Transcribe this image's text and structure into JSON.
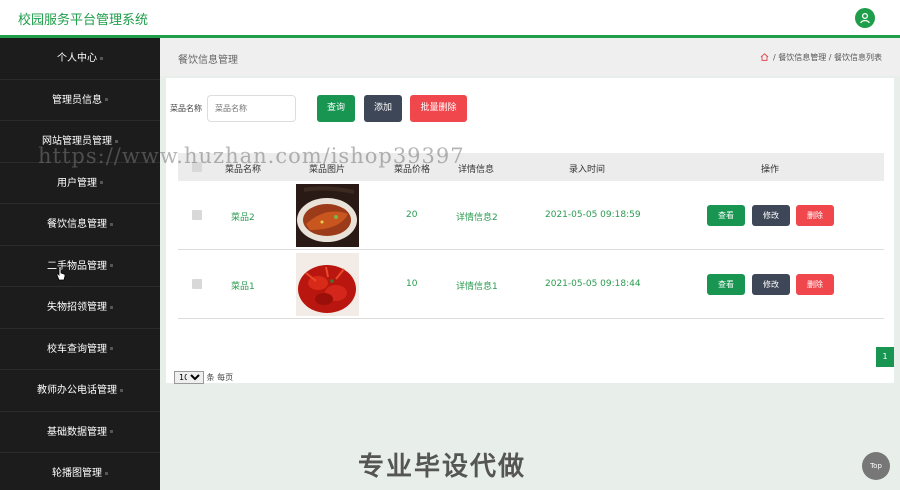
{
  "header": {
    "app_title": "校园服务平台管理系统",
    "user_icon": "user-icon",
    "accent": "#1e9e4a"
  },
  "sidebar": {
    "items": [
      {
        "label": "个人中心"
      },
      {
        "label": "管理员信息"
      },
      {
        "label": "网站管理员管理"
      },
      {
        "label": "用户管理"
      },
      {
        "label": "餐饮信息管理"
      },
      {
        "label": "二手物品管理"
      },
      {
        "label": "失物招领管理"
      },
      {
        "label": "校车查询管理"
      },
      {
        "label": "教师办公电话管理"
      },
      {
        "label": "基础数据管理"
      },
      {
        "label": "轮播图管理"
      }
    ]
  },
  "page": {
    "title": "餐饮信息管理",
    "breadcrumb": {
      "level1": "餐饮信息管理",
      "sep": "/",
      "level2": "餐饮信息列表"
    }
  },
  "search": {
    "label": "菜品名称",
    "placeholder": "菜品名称",
    "query_label": "查询",
    "add_label": "添加",
    "batch_delete_label": "批量删除"
  },
  "table": {
    "columns": [
      "菜品名称",
      "菜品图片",
      "菜品价格",
      "详情信息",
      "录入时间",
      "操作"
    ],
    "rows": [
      {
        "name": "菜品2",
        "price": "20",
        "detail": "详情信息2",
        "time": "2021-05-05 09:18:59"
      },
      {
        "name": "菜品1",
        "price": "10",
        "detail": "详情信息1",
        "time": "2021-05-05 09:18:44"
      }
    ],
    "actions": {
      "view": "查看",
      "edit": "修改",
      "delete": "删除"
    }
  },
  "pagination": {
    "page_size": "10",
    "page_size_suffix": "条 每页",
    "current_page": "1"
  },
  "overlay": {
    "watermark_url": "https://www.huzhan.com/ishop39397",
    "watermark_cn": "专业毕设代做",
    "top_button": "Top"
  }
}
